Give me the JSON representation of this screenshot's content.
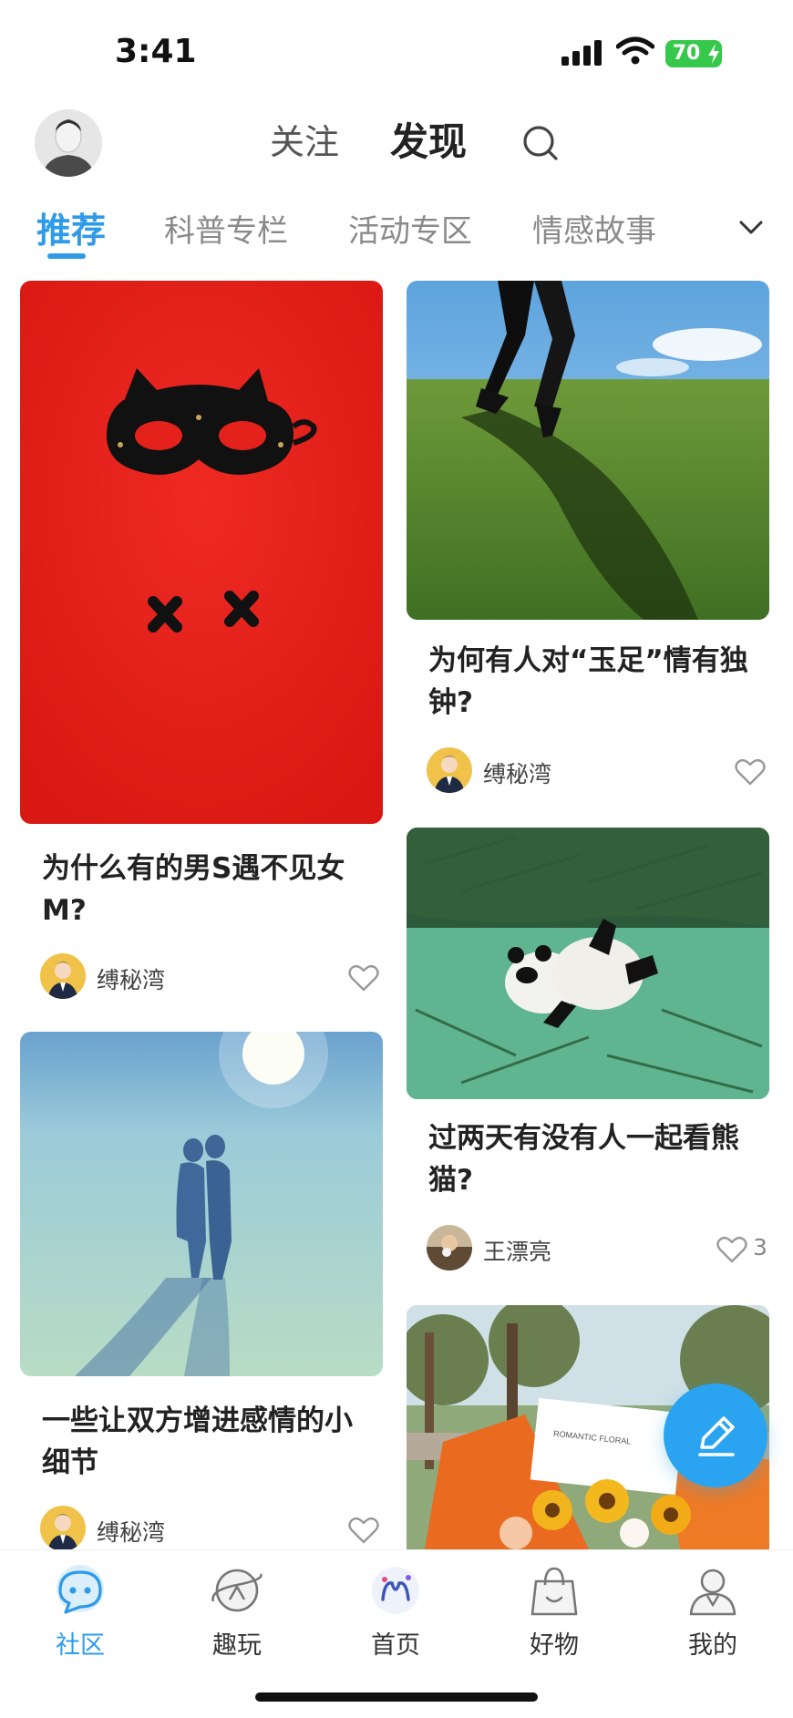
{
  "status_bar": {
    "time": "3:41",
    "battery": "70"
  },
  "header": {
    "tabs": [
      "关注",
      "发现"
    ]
  },
  "categories": [
    "推荐",
    "科普专栏",
    "活动专区",
    "情感故事"
  ],
  "feed": [
    {
      "title": "为什么有的男S遇不见女M?",
      "author": "缚秘湾",
      "likes": ""
    },
    {
      "title": "为何有人对“玉足”情有独钟?",
      "author": "缚秘湾",
      "likes": ""
    },
    {
      "title": "一些让双方增进感情的小细节",
      "author": "缚秘湾",
      "likes": ""
    },
    {
      "title": "过两天有没有人一起看熊猫?",
      "author": "王漂亮",
      "likes": "3"
    },
    {
      "image_text": "ROMANTIC FLORAL"
    }
  ],
  "bottom_nav": [
    {
      "label": "社区",
      "icon": "community-icon",
      "active": true
    },
    {
      "label": "趣玩",
      "icon": "planet-icon",
      "active": false
    },
    {
      "label": "首页",
      "icon": "home-logo-icon",
      "active": false
    },
    {
      "label": "好物",
      "icon": "shopping-bag-icon",
      "active": false
    },
    {
      "label": "我的",
      "icon": "profile-icon",
      "active": false
    }
  ],
  "colors": {
    "accent": "#2f9be8",
    "battery": "#36c84a",
    "fab": "#2aa4f0"
  }
}
